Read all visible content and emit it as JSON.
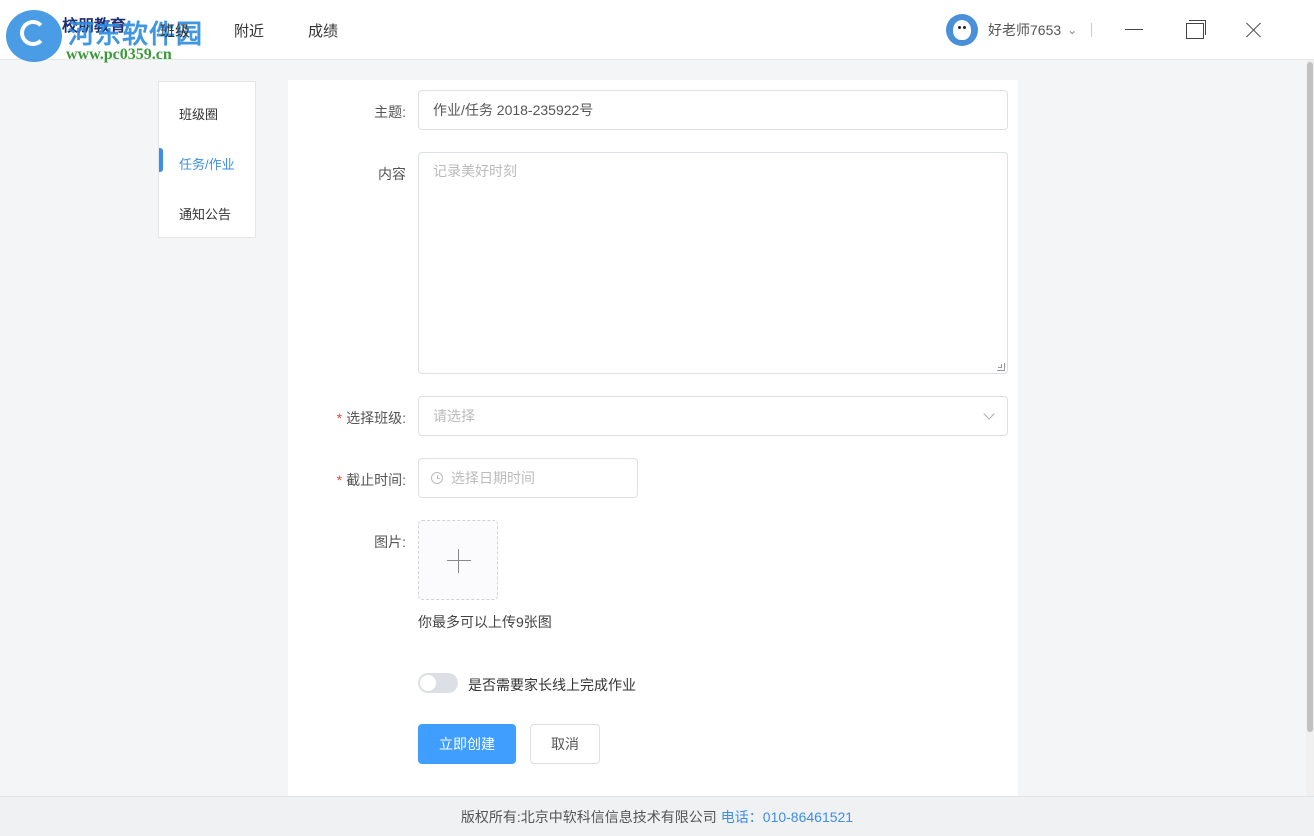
{
  "header": {
    "logo_text": "校朋教育",
    "watermark_text": "河东软件园",
    "watermark_url": "www.pc0359.cn",
    "nav": [
      "班级",
      "附近",
      "成绩"
    ],
    "user_name": "好老师7653"
  },
  "sidebar": {
    "items": [
      {
        "label": "班级圈",
        "active": false
      },
      {
        "label": "任务/作业",
        "active": true
      },
      {
        "label": "通知公告",
        "active": false
      }
    ]
  },
  "form": {
    "subject_label": "主题:",
    "subject_value": "作业/任务 2018-235922号",
    "content_label": "内容",
    "content_placeholder": "记录美好时刻",
    "class_label": "选择班级:",
    "class_placeholder": "请选择",
    "deadline_label": "截止时间:",
    "deadline_placeholder": "选择日期时间",
    "image_label": "图片:",
    "upload_hint": "你最多可以上传9张图",
    "toggle_label": "是否需要家长线上完成作业",
    "toggle_on": false,
    "required_mark": "*",
    "create_button": "立即创建",
    "cancel_button": "取消"
  },
  "footer": {
    "copyright": "版权所有:北京中软科信信息技术有限公司",
    "phone": "电话：010-86461521"
  },
  "colors": {
    "accent": "#409eff",
    "required": "#e84b3c"
  }
}
